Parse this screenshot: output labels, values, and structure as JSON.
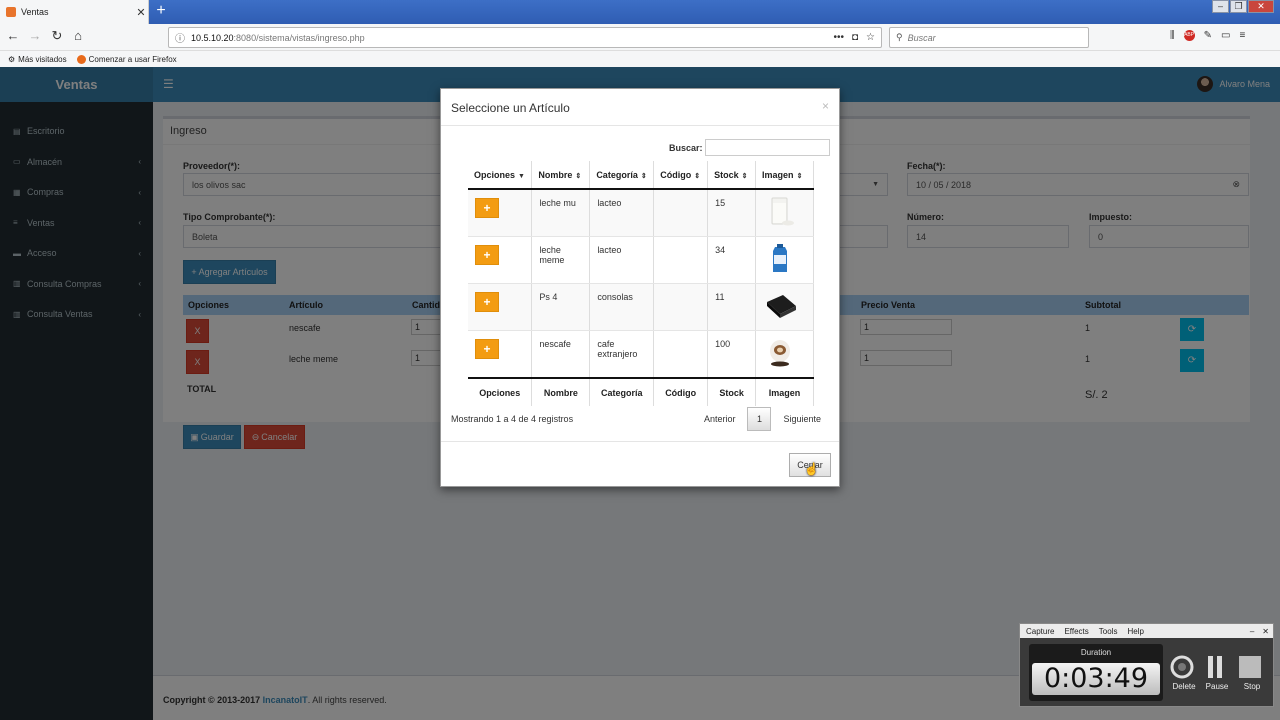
{
  "browser": {
    "tab_title": "Ventas",
    "url_host": "10.5.10.20",
    "url_path": ":8080/sistema/vistas/ingreso.php",
    "search_placeholder": "Buscar",
    "bookmarks": [
      "Más visitados",
      "Comenzar a usar Firefox"
    ]
  },
  "app": {
    "logo": "Ventas",
    "user_name": "Alvaro Mena",
    "sidebar": [
      {
        "label": "Escritorio",
        "icon": "dashboard-icon"
      },
      {
        "label": "Almacén",
        "icon": "laptop-icon"
      },
      {
        "label": "Compras",
        "icon": "grid-icon"
      },
      {
        "label": "Ventas",
        "icon": "list-icon"
      },
      {
        "label": "Acceso",
        "icon": "folder-icon"
      },
      {
        "label": "Consulta Compras",
        "icon": "chart-icon"
      },
      {
        "label": "Consulta Ventas",
        "icon": "chart-icon"
      }
    ]
  },
  "form": {
    "title": "Ingreso",
    "proveedor_label": "Proveedor(*):",
    "proveedor_value": "los olivos sac",
    "fecha_label": "Fecha(*):",
    "fecha_value": "10 / 05 / 2018",
    "tipo_label": "Tipo Comprobante(*):",
    "tipo_value": "Boleta",
    "numero_label": "Número:",
    "numero_value": "14",
    "impuesto_label": "Impuesto:",
    "impuesto_value": "0",
    "add_button": "Agregar Artículos",
    "columns": [
      "Opciones",
      "Artículo",
      "Cantid",
      "Precio Venta",
      "Subtotal"
    ],
    "rows": [
      {
        "delete": "X",
        "articulo": "nescafe",
        "cantidad": "1",
        "precio_venta": "1",
        "subtotal": "1"
      },
      {
        "delete": "X",
        "articulo": "leche meme",
        "cantidad": "1",
        "precio_venta": "1",
        "subtotal": "1"
      }
    ],
    "total_label": "TOTAL",
    "total_value": "S/. 2",
    "save_button": "Guardar",
    "cancel_button": "Cancelar"
  },
  "footer": {
    "prefix": "Copyright © 2013-2017 ",
    "brand": "IncanatoIT",
    "suffix": ". All rights reserved."
  },
  "modal": {
    "title": "Seleccione un Artículo",
    "search_label": "Buscar:",
    "columns": [
      "Opciones",
      "Nombre",
      "Categoría",
      "Código",
      "Stock",
      "Imagen"
    ],
    "rows": [
      {
        "nombre": "leche mu",
        "categoria": "lacteo",
        "codigo": "",
        "stock": "15",
        "image": "milk-glass-image"
      },
      {
        "nombre": "leche meme",
        "categoria": "lacteo",
        "codigo": "",
        "stock": "34",
        "image": "milk-carton-image"
      },
      {
        "nombre": "Ps 4",
        "categoria": "consolas",
        "codigo": "",
        "stock": "11",
        "image": "console-image"
      },
      {
        "nombre": "nescafe",
        "categoria": "cafe extranjero",
        "codigo": "",
        "stock": "100",
        "image": "coffee-cup-image"
      }
    ],
    "add_symbol": "+",
    "showing": "Mostrando 1 a 4 de 4 registros",
    "prev": "Anterior",
    "page": "1",
    "next": "Siguiente",
    "close_button": "Cerrar",
    "accent": "#f39c12"
  },
  "recorder": {
    "menu": [
      "Capture",
      "Effects",
      "Tools",
      "Help"
    ],
    "duration_label": "Duration",
    "duration": "0:03:49",
    "buttons": [
      "Delete",
      "Pause",
      "Stop"
    ]
  }
}
